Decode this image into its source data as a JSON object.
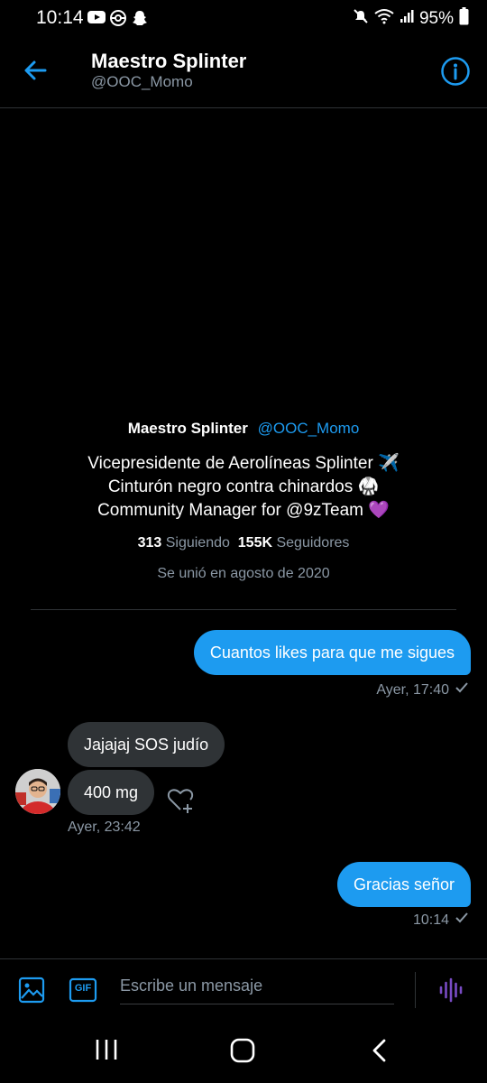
{
  "status": {
    "time": "10:14",
    "battery": "95%"
  },
  "header": {
    "name": "Maestro Splinter",
    "handle": "@OOC_Momo"
  },
  "profile": {
    "name": "Maestro Splinter",
    "handle": "@OOC_Momo",
    "bio": [
      "Vicepresidente de Aerolíneas Splinter ✈️",
      "Cinturón negro contra chinardos 🥋",
      "Community Manager for @9zTeam 💜"
    ],
    "following_count": "313",
    "following_label": "Siguiendo",
    "followers_count": "155K",
    "followers_label": "Seguidores",
    "joined": "Se unió en agosto de 2020"
  },
  "messages": [
    {
      "from": "me",
      "text": "Cuantos likes para que me sigues",
      "time": "Ayer, 17:40"
    },
    {
      "from": "them",
      "text": "Jajajaj SOS judío"
    },
    {
      "from": "them",
      "text": "400 mg",
      "time": "Ayer, 23:42"
    },
    {
      "from": "me",
      "text": "Gracias señor",
      "time": "10:14"
    }
  ],
  "composer": {
    "placeholder": "Escribe un mensaje",
    "gif_label": "GIF"
  },
  "colors": {
    "accent": "#1d9bf0",
    "voice": "#794bc4",
    "background": "#000000"
  }
}
